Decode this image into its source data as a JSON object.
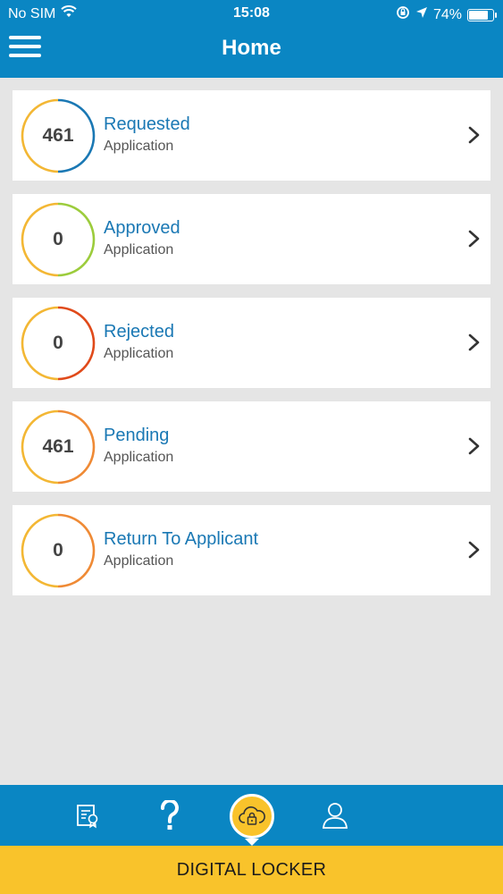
{
  "status_bar": {
    "carrier": "No SIM",
    "time": "15:08",
    "battery": "74%",
    "battery_level": 0.74
  },
  "header": {
    "title": "Home",
    "menu_icon": "hamburger-icon"
  },
  "cards": [
    {
      "count": "461",
      "label": "Requested",
      "sub": "Application",
      "ring_colors": [
        "#f3b734",
        "#1a78b4"
      ]
    },
    {
      "count": "0",
      "label": "Approved",
      "sub": "Application",
      "ring_colors": [
        "#f3b734",
        "#9ccc3c"
      ]
    },
    {
      "count": "0",
      "label": "Rejected",
      "sub": "Application",
      "ring_colors": [
        "#f3b734",
        "#e04a1a"
      ]
    },
    {
      "count": "461",
      "label": "Pending",
      "sub": "Application",
      "ring_colors": [
        "#f3b734",
        "#ef8a35"
      ]
    },
    {
      "count": "0",
      "label": "Return To Applicant",
      "sub": "Application",
      "ring_colors": [
        "#f3b734",
        "#ef8a35"
      ]
    }
  ],
  "bottom_nav": {
    "items": [
      "certificate-icon",
      "help-icon",
      "cloud-lock-icon",
      "user-icon"
    ],
    "locker_label": "DIGITAL LOCKER"
  },
  "colors": {
    "primary": "#0a86c3",
    "accent": "#f9c32b",
    "background": "#e5e5e5"
  }
}
